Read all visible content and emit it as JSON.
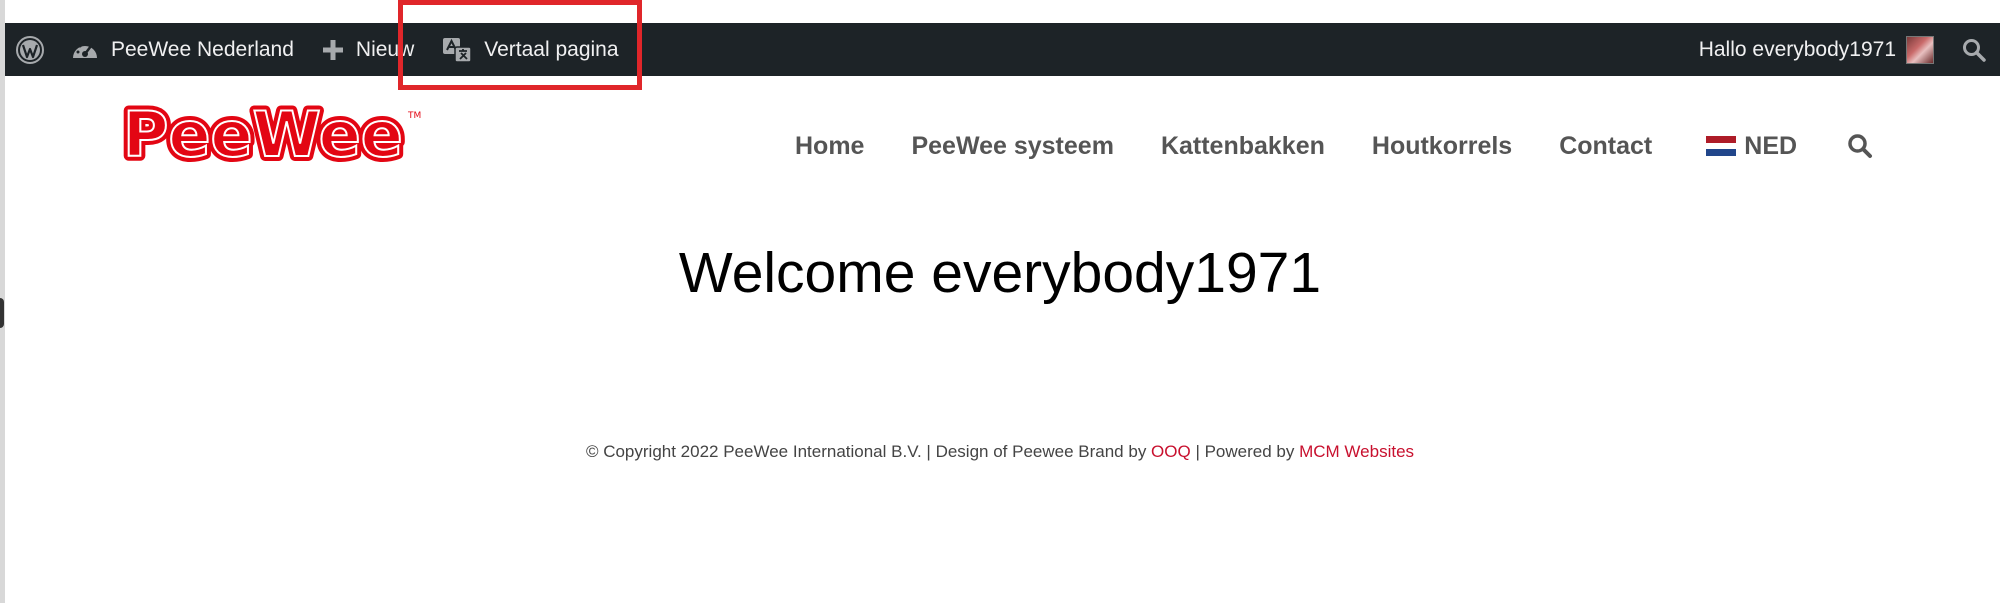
{
  "admin_bar": {
    "site_name": "PeeWee Nederland",
    "new_label": "Nieuw",
    "translate_label": "Vertaal pagina",
    "greeting": "Hallo everybody1971"
  },
  "header": {
    "logo_text": "PeeWee",
    "logo_tm": "TM",
    "nav": [
      {
        "label": "Home"
      },
      {
        "label": "PeeWee systeem"
      },
      {
        "label": "Kattenbakken"
      },
      {
        "label": "Houtkorrels"
      },
      {
        "label": "Contact"
      }
    ],
    "language": "NED"
  },
  "main": {
    "title": "Welcome everybody1971"
  },
  "footer": {
    "copyright": "© Copyright 2022 PeeWee International B.V.",
    "sep1": " | ",
    "design_text": "Design of Peewee Brand by ",
    "design_link": "OOQ",
    "sep2": " | ",
    "powered_text": "Powered by ",
    "powered_link": "MCM Websites"
  },
  "colors": {
    "admin_bar_bg": "#1d2327",
    "brand_red": "#e30613",
    "link_red": "#c8102e",
    "nav_text": "#555555",
    "highlight": "#e0262a"
  },
  "icons": {
    "wp": "wordpress-logo-icon",
    "dashboard": "dashboard-gauge-icon",
    "new": "plus-icon",
    "translate": "translate-icon",
    "search_admin": "search-icon",
    "search_nav": "search-icon",
    "flag": "netherlands-flag-icon"
  }
}
